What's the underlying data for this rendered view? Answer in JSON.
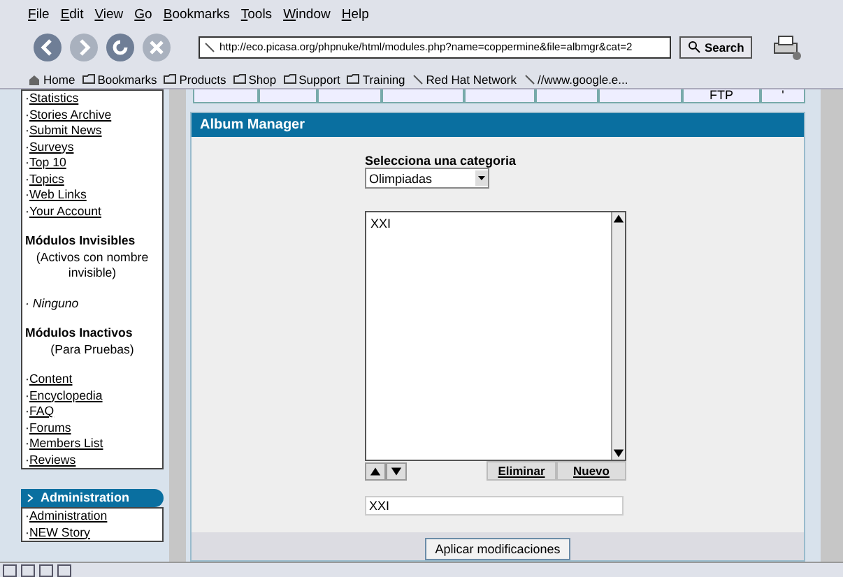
{
  "menu": [
    "File",
    "Edit",
    "View",
    "Go",
    "Bookmarks",
    "Tools",
    "Window",
    "Help"
  ],
  "address": "http://eco.picasa.org/phpnuke/html/modules.php?name=coppermine&file=albmgr&cat=2",
  "search_button": "Search",
  "bookmarks": [
    {
      "kind": "home",
      "label": "Home"
    },
    {
      "kind": "folder",
      "label": "Bookmarks"
    },
    {
      "kind": "folder",
      "label": "Products"
    },
    {
      "kind": "folder",
      "label": "Shop"
    },
    {
      "kind": "folder",
      "label": "Support"
    },
    {
      "kind": "folder",
      "label": "Training"
    },
    {
      "kind": "link",
      "label": "Red Hat Network"
    },
    {
      "kind": "link",
      "label": "//www.google.e..."
    }
  ],
  "bullet": "·",
  "sidebar": [
    {
      "kind": "link",
      "label": "Statistics"
    },
    {
      "kind": "link",
      "label": "Stories Archive"
    },
    {
      "kind": "link",
      "label": "Submit News"
    },
    {
      "kind": "link",
      "label": "Surveys"
    },
    {
      "kind": "link",
      "label": "Top 10"
    },
    {
      "kind": "link",
      "label": "Topics"
    },
    {
      "kind": "link",
      "label": "Web Links"
    },
    {
      "kind": "link",
      "label": "Your Account"
    },
    {
      "kind": "heading",
      "label": "Módulos Invisibles"
    },
    {
      "kind": "note",
      "label": "(Activos con nombre invisible)"
    },
    {
      "kind": "none",
      "label": "Ninguno"
    },
    {
      "kind": "heading",
      "label": "Módulos Inactivos"
    },
    {
      "kind": "note",
      "label": "(Para Pruebas)"
    },
    {
      "kind": "link",
      "label": "Content"
    },
    {
      "kind": "link",
      "label": "Encyclopedia"
    },
    {
      "kind": "link",
      "label": "FAQ"
    },
    {
      "kind": "link",
      "label": "Forums"
    },
    {
      "kind": "link",
      "label": "Members List"
    },
    {
      "kind": "link",
      "label": "Reviews"
    }
  ],
  "admin": {
    "title": "Administration",
    "links": [
      "Administration",
      "NEW Story"
    ]
  },
  "tab_strip": [
    "FTP",
    "'"
  ],
  "panel": {
    "title": "Album Manager",
    "select_label": "Selecciona una categoria",
    "category": "Olimpiadas",
    "albums": [
      {
        "label": "XXI",
        "selected": false
      }
    ],
    "delete_button": "Eliminar",
    "new_button": "Nuevo",
    "album_name": "XXI",
    "apply_button": "Aplicar modificaciones"
  }
}
